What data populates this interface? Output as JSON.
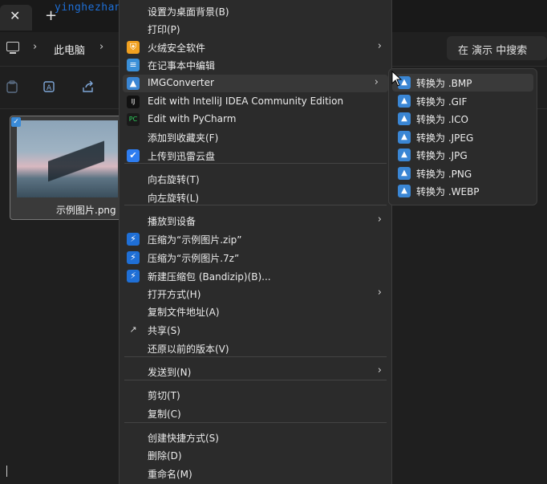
{
  "tab": {
    "close_glyph": "✕",
    "add_glyph": "+"
  },
  "watermark": "yinghezhan.com",
  "address": {
    "crumb": "此电脑",
    "search_text": "在 演示 中搜索"
  },
  "file": {
    "name": "示例图片.png"
  },
  "menu": {
    "items": [
      {
        "label": "设置为桌面背景(B)",
        "icon": "",
        "submenu": false
      },
      {
        "label": "打印(P)",
        "icon": "",
        "submenu": false
      },
      {
        "label": "火绒安全软件",
        "icon": "huorong-shield-icon",
        "submenu": true
      },
      {
        "label": "在记事本中编辑",
        "icon": "notepad-icon",
        "submenu": false
      },
      {
        "label": "IMGConverter",
        "icon": "imgconverter-icon",
        "submenu": true
      },
      {
        "label": "Edit with IntelliJ IDEA Community Edition",
        "icon": "intellij-icon",
        "submenu": false
      },
      {
        "label": "Edit with PyCharm",
        "icon": "pycharm-icon",
        "submenu": false
      },
      {
        "label": "添加到收藏夹(F)",
        "icon": "",
        "submenu": false
      },
      {
        "label": "上传到迅雷云盘",
        "icon": "xunlei-icon",
        "submenu": false
      },
      {
        "label": "向右旋转(T)",
        "icon": "",
        "submenu": false
      },
      {
        "label": "向左旋转(L)",
        "icon": "",
        "submenu": false
      },
      {
        "label": "播放到设备",
        "icon": "",
        "submenu": true
      },
      {
        "label": "压缩为“示例图片.zip”",
        "icon": "bandizip-icon",
        "submenu": false
      },
      {
        "label": "压缩为“示例图片.7z”",
        "icon": "bandizip-icon",
        "submenu": false
      },
      {
        "label": "新建压缩包 (Bandizip)(B)...",
        "icon": "bandizip-icon",
        "submenu": false
      },
      {
        "label": "打开方式(H)",
        "icon": "",
        "submenu": true
      },
      {
        "label": "复制文件地址(A)",
        "icon": "",
        "submenu": false
      },
      {
        "label": "共享(S)",
        "icon": "share-icon",
        "submenu": false
      },
      {
        "label": "还原以前的版本(V)",
        "icon": "",
        "submenu": false
      },
      {
        "label": "发送到(N)",
        "icon": "",
        "submenu": true
      },
      {
        "label": "剪切(T)",
        "icon": "",
        "submenu": false
      },
      {
        "label": "复制(C)",
        "icon": "",
        "submenu": false
      },
      {
        "label": "创建快捷方式(S)",
        "icon": "",
        "submenu": false
      },
      {
        "label": "删除(D)",
        "icon": "",
        "submenu": false
      },
      {
        "label": "重命名(M)",
        "icon": "",
        "submenu": false
      }
    ]
  },
  "submenu": {
    "items": [
      {
        "label": "转换为 .BMP"
      },
      {
        "label": "转换为 .GIF"
      },
      {
        "label": "转换为 .ICO"
      },
      {
        "label": "转换为 .JPEG"
      },
      {
        "label": "转换为 .JPG"
      },
      {
        "label": "转换为 .PNG"
      },
      {
        "label": "转换为 .WEBP"
      }
    ]
  },
  "colors": {
    "accent": "#3a86d4",
    "menu_bg": "#2b2b2b",
    "hover_bg": "#383838"
  }
}
